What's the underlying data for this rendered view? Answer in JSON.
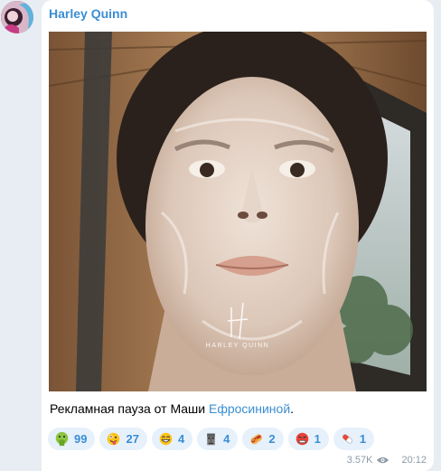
{
  "message": {
    "sender": "Harley Quinn",
    "photo_alt": "selfie",
    "watermark": "HARLEY QUINN",
    "caption_prefix": "Рекламная пауза от Маши ",
    "caption_link": "Ефросининой",
    "caption_suffix": "."
  },
  "reactions": [
    {
      "icon": "vomit-face-icon",
      "count": "99"
    },
    {
      "icon": "zany-face-icon",
      "count": "27"
    },
    {
      "icon": "grin-face-icon",
      "count": "4"
    },
    {
      "icon": "moai-icon",
      "count": "4"
    },
    {
      "icon": "hotdog-icon",
      "count": "2"
    },
    {
      "icon": "angry-face-icon",
      "count": "1"
    },
    {
      "icon": "pill-icon",
      "count": "1"
    }
  ],
  "meta": {
    "views": "3.57K",
    "time": "20:12"
  },
  "colors": {
    "accent": "#3a8ed3",
    "reaction_bg": "#e6f1fb",
    "chat_bg": "#e7edf2"
  }
}
